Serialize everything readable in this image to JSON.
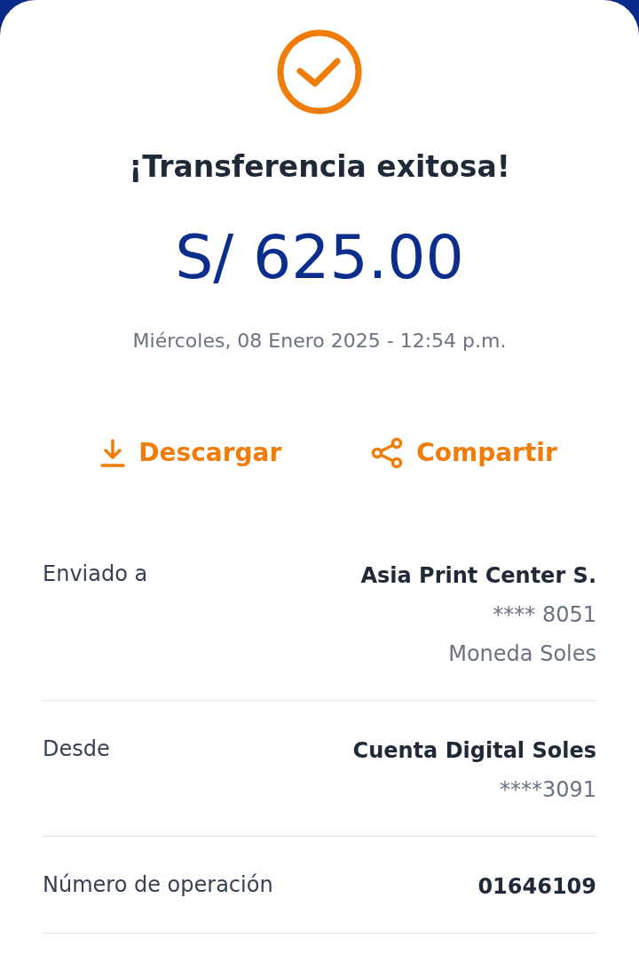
{
  "title": "¡Transferencia exitosa!",
  "amount": "S/ 625.00",
  "datetime": "Miércoles, 08 Enero 2025 - 12:54 p.m.",
  "actions": [
    {
      "kind": "download",
      "label": "Descargar"
    },
    {
      "kind": "share",
      "label": "Compartir"
    }
  ],
  "details": [
    {
      "label": "Enviado a",
      "values": [
        {
          "kind": "strong",
          "text": "Asia Print Center S."
        },
        {
          "kind": "plain",
          "text": "**** 8051"
        },
        {
          "kind": "plain",
          "text": "Moneda Soles"
        }
      ]
    },
    {
      "label": "Desde",
      "values": [
        {
          "kind": "strong",
          "text": "Cuenta Digital Soles"
        },
        {
          "kind": "plain",
          "text": "****3091"
        }
      ]
    },
    {
      "label": "Número de operación",
      "values": [
        {
          "kind": "strong",
          "text": "01646109"
        }
      ]
    }
  ]
}
